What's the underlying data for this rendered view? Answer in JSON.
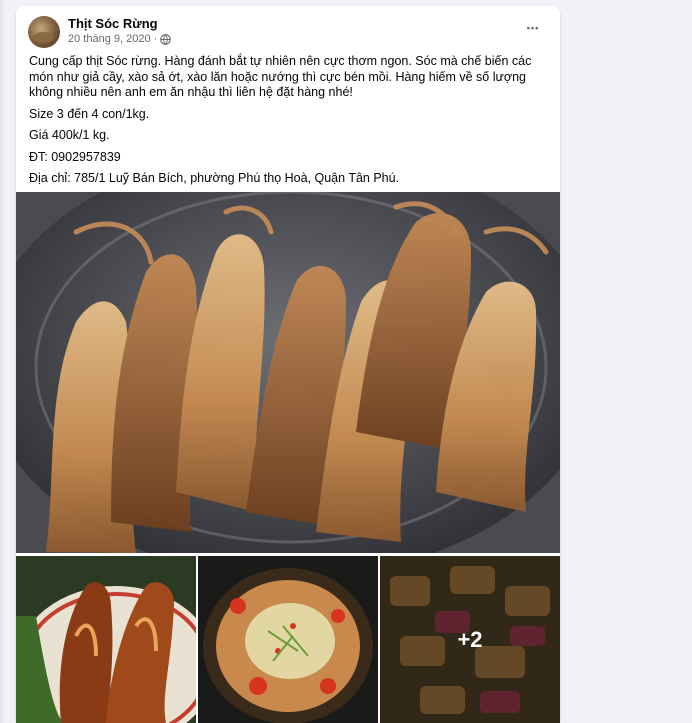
{
  "post": {
    "page_name": "Thịt Sóc Rừng",
    "date": "20 tháng 9, 2020",
    "separator": "·",
    "more_label": "•••",
    "paragraphs": [
      "Cung cấp thịt Sóc rừng. Hàng đánh bắt tự nhiên nên cực  thơm ngon. Sóc mà chế biến các món như giả cầy, xào sả ớt, xào lăn hoặc nướng thì cực bén mồi. Hàng hiếm về số lượng không nhiều nên anh em ăn nhậu thì liên hệ đặt hàng nhé!",
      "Size 3 đến 4 con/1kg.",
      "Giá 400k/1 kg.",
      "ĐT: 0902957839",
      "Địa chỉ: 785/1 Luỹ Bán Bích, phường Phú thọ Hoà, Quận Tân Phú."
    ]
  },
  "photos": {
    "more_count_label": "+2"
  },
  "icons": {
    "globe": "globe-icon",
    "more": "more-icon"
  },
  "colors": {
    "page_bg": "#f0f2f5",
    "card_bg": "#ffffff",
    "text_primary": "#050505",
    "text_secondary": "#65676b"
  }
}
